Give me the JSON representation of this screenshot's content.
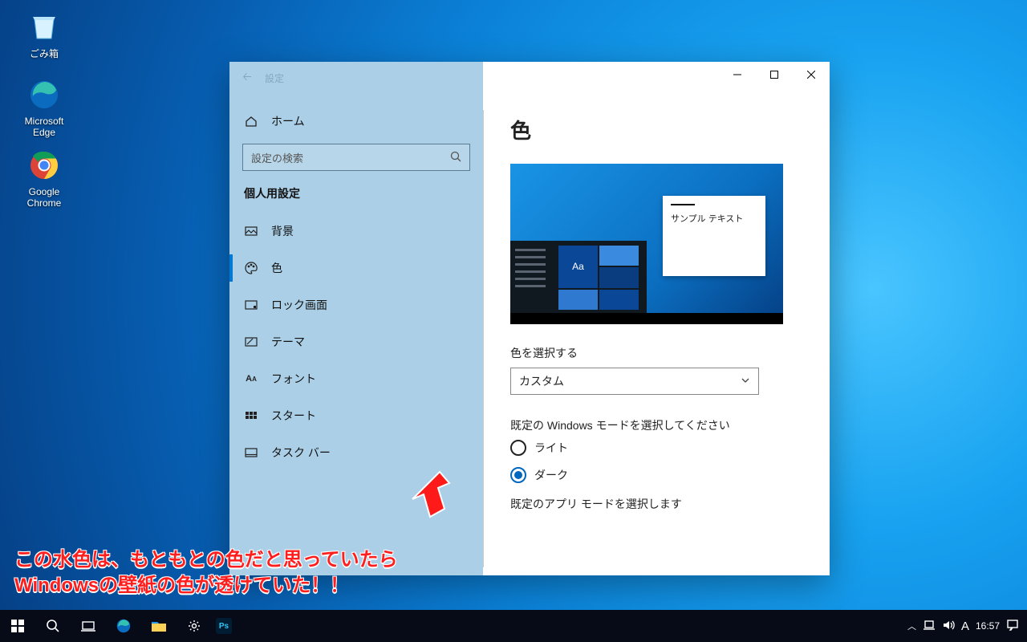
{
  "desktop": {
    "icons": [
      {
        "name": "recycle-bin",
        "label": "ごみ箱"
      },
      {
        "name": "msedge",
        "label": "Microsoft Edge"
      },
      {
        "name": "chrome",
        "label": "Google Chrome"
      }
    ]
  },
  "window": {
    "back_label": "←",
    "title": "設定",
    "sidebar": {
      "home": "ホーム",
      "search_placeholder": "設定の検索",
      "heading": "個人用設定",
      "items": [
        {
          "label": "背景",
          "selected": false
        },
        {
          "label": "色",
          "selected": true
        },
        {
          "label": "ロック画面",
          "selected": false
        },
        {
          "label": "テーマ",
          "selected": false
        },
        {
          "label": "フォント",
          "selected": false
        },
        {
          "label": "スタート",
          "selected": false
        },
        {
          "label": "タスク バー",
          "selected": false
        }
      ]
    },
    "content": {
      "title": "色",
      "preview_sample": "サンプル テキスト",
      "preview_tile": "Aa",
      "select_color_label": "色を選択する",
      "select_value": "カスタム",
      "windows_mode_label": "既定の Windows モードを選択してください",
      "radio_light": "ライト",
      "radio_dark": "ダーク",
      "app_mode_label": "既定のアプリ モードを選択します"
    }
  },
  "taskbar": {
    "time": "16:57",
    "ime": "A"
  },
  "annotation": {
    "line1": "この水色は、もともとの色だと思っていたら",
    "line2": "Windowsの壁紙の色が透けていた！！"
  }
}
